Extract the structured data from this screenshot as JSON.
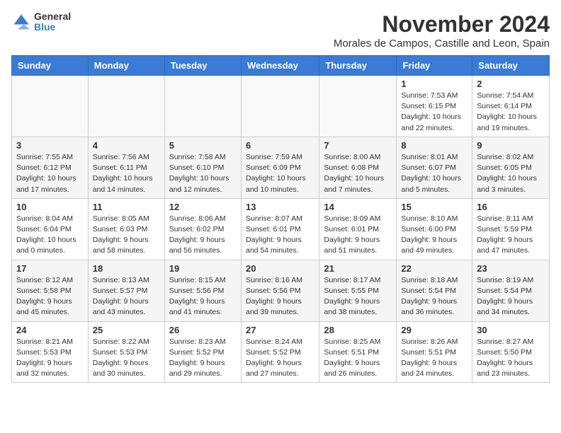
{
  "header": {
    "logo_general": "General",
    "logo_blue": "Blue",
    "month_title": "November 2024",
    "location": "Morales de Campos, Castille and Leon, Spain"
  },
  "weekdays": [
    "Sunday",
    "Monday",
    "Tuesday",
    "Wednesday",
    "Thursday",
    "Friday",
    "Saturday"
  ],
  "weeks": [
    [
      {
        "day": "",
        "info": ""
      },
      {
        "day": "",
        "info": ""
      },
      {
        "day": "",
        "info": ""
      },
      {
        "day": "",
        "info": ""
      },
      {
        "day": "",
        "info": ""
      },
      {
        "day": "1",
        "info": "Sunrise: 7:53 AM\nSunset: 6:15 PM\nDaylight: 10 hours and 22 minutes."
      },
      {
        "day": "2",
        "info": "Sunrise: 7:54 AM\nSunset: 6:14 PM\nDaylight: 10 hours and 19 minutes."
      }
    ],
    [
      {
        "day": "3",
        "info": "Sunrise: 7:55 AM\nSunset: 6:12 PM\nDaylight: 10 hours and 17 minutes."
      },
      {
        "day": "4",
        "info": "Sunrise: 7:56 AM\nSunset: 6:11 PM\nDaylight: 10 hours and 14 minutes."
      },
      {
        "day": "5",
        "info": "Sunrise: 7:58 AM\nSunset: 6:10 PM\nDaylight: 10 hours and 12 minutes."
      },
      {
        "day": "6",
        "info": "Sunrise: 7:59 AM\nSunset: 6:09 PM\nDaylight: 10 hours and 10 minutes."
      },
      {
        "day": "7",
        "info": "Sunrise: 8:00 AM\nSunset: 6:08 PM\nDaylight: 10 hours and 7 minutes."
      },
      {
        "day": "8",
        "info": "Sunrise: 8:01 AM\nSunset: 6:07 PM\nDaylight: 10 hours and 5 minutes."
      },
      {
        "day": "9",
        "info": "Sunrise: 8:02 AM\nSunset: 6:05 PM\nDaylight: 10 hours and 3 minutes."
      }
    ],
    [
      {
        "day": "10",
        "info": "Sunrise: 8:04 AM\nSunset: 6:04 PM\nDaylight: 10 hours and 0 minutes."
      },
      {
        "day": "11",
        "info": "Sunrise: 8:05 AM\nSunset: 6:03 PM\nDaylight: 9 hours and 58 minutes."
      },
      {
        "day": "12",
        "info": "Sunrise: 8:06 AM\nSunset: 6:02 PM\nDaylight: 9 hours and 56 minutes."
      },
      {
        "day": "13",
        "info": "Sunrise: 8:07 AM\nSunset: 6:01 PM\nDaylight: 9 hours and 54 minutes."
      },
      {
        "day": "14",
        "info": "Sunrise: 8:09 AM\nSunset: 6:01 PM\nDaylight: 9 hours and 51 minutes."
      },
      {
        "day": "15",
        "info": "Sunrise: 8:10 AM\nSunset: 6:00 PM\nDaylight: 9 hours and 49 minutes."
      },
      {
        "day": "16",
        "info": "Sunrise: 8:11 AM\nSunset: 5:59 PM\nDaylight: 9 hours and 47 minutes."
      }
    ],
    [
      {
        "day": "17",
        "info": "Sunrise: 8:12 AM\nSunset: 5:58 PM\nDaylight: 9 hours and 45 minutes."
      },
      {
        "day": "18",
        "info": "Sunrise: 8:13 AM\nSunset: 5:57 PM\nDaylight: 9 hours and 43 minutes."
      },
      {
        "day": "19",
        "info": "Sunrise: 8:15 AM\nSunset: 5:56 PM\nDaylight: 9 hours and 41 minutes."
      },
      {
        "day": "20",
        "info": "Sunrise: 8:16 AM\nSunset: 5:56 PM\nDaylight: 9 hours and 39 minutes."
      },
      {
        "day": "21",
        "info": "Sunrise: 8:17 AM\nSunset: 5:55 PM\nDaylight: 9 hours and 38 minutes."
      },
      {
        "day": "22",
        "info": "Sunrise: 8:18 AM\nSunset: 5:54 PM\nDaylight: 9 hours and 36 minutes."
      },
      {
        "day": "23",
        "info": "Sunrise: 8:19 AM\nSunset: 5:54 PM\nDaylight: 9 hours and 34 minutes."
      }
    ],
    [
      {
        "day": "24",
        "info": "Sunrise: 8:21 AM\nSunset: 5:53 PM\nDaylight: 9 hours and 32 minutes."
      },
      {
        "day": "25",
        "info": "Sunrise: 8:22 AM\nSunset: 5:53 PM\nDaylight: 9 hours and 30 minutes."
      },
      {
        "day": "26",
        "info": "Sunrise: 8:23 AM\nSunset: 5:52 PM\nDaylight: 9 hours and 29 minutes."
      },
      {
        "day": "27",
        "info": "Sunrise: 8:24 AM\nSunset: 5:52 PM\nDaylight: 9 hours and 27 minutes."
      },
      {
        "day": "28",
        "info": "Sunrise: 8:25 AM\nSunset: 5:51 PM\nDaylight: 9 hours and 26 minutes."
      },
      {
        "day": "29",
        "info": "Sunrise: 8:26 AM\nSunset: 5:51 PM\nDaylight: 9 hours and 24 minutes."
      },
      {
        "day": "30",
        "info": "Sunrise: 8:27 AM\nSunset: 5:50 PM\nDaylight: 9 hours and 23 minutes."
      }
    ]
  ]
}
